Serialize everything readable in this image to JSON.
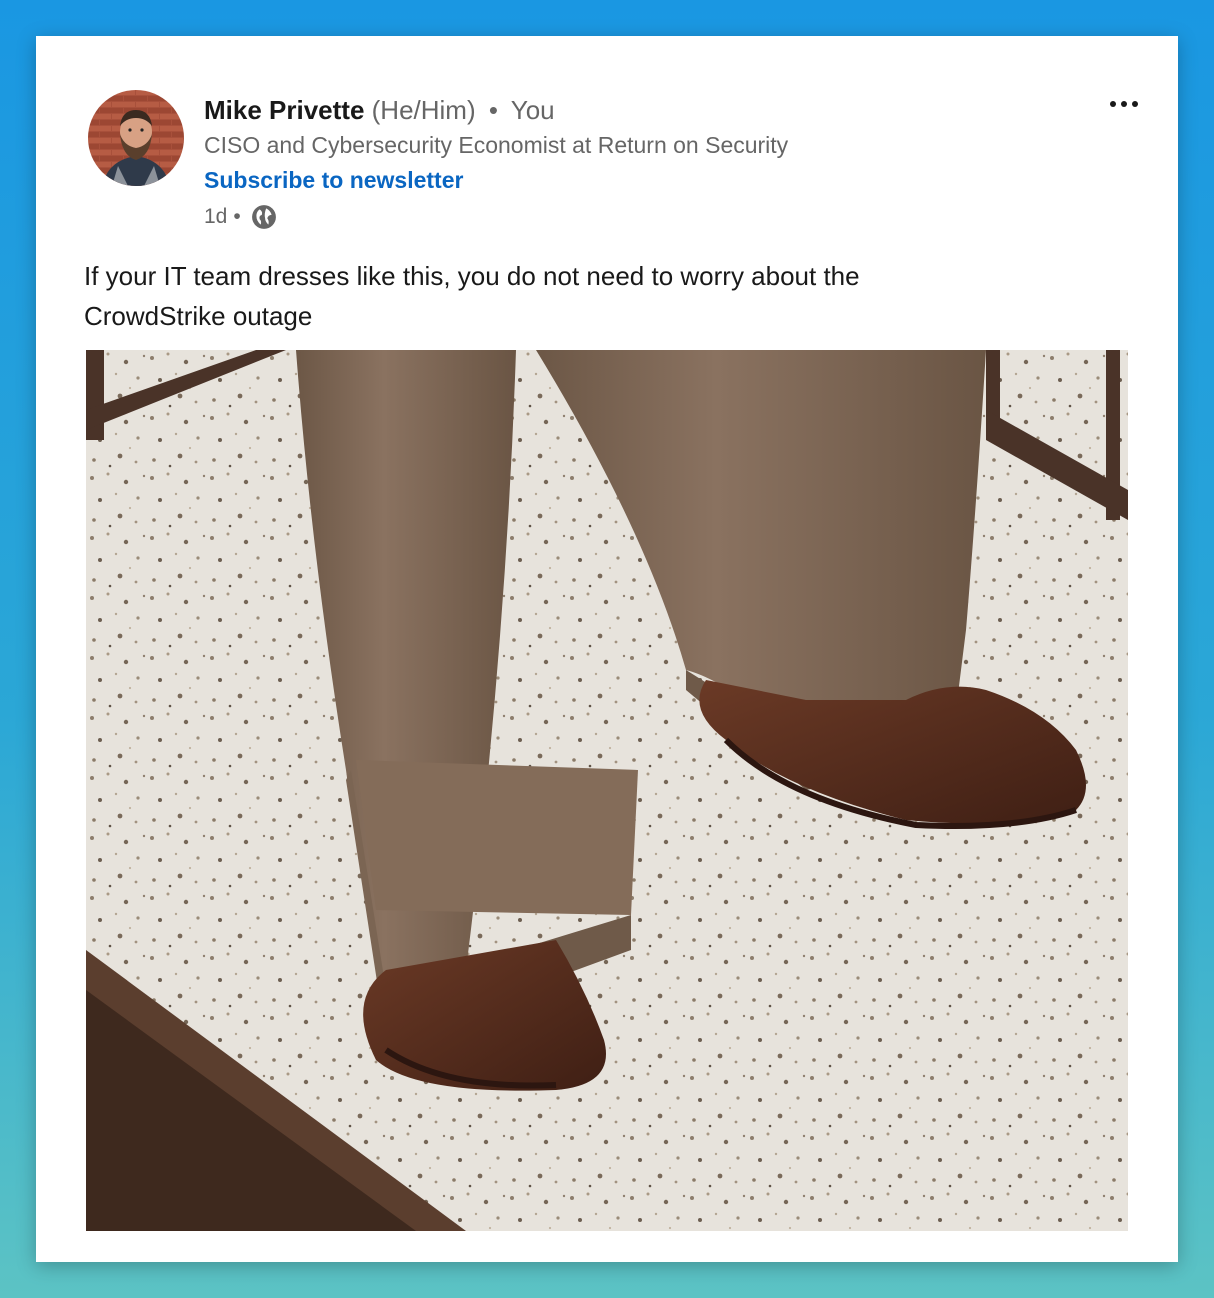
{
  "post": {
    "author": {
      "name": "Mike Privette",
      "pronouns": "(He/Him)",
      "connection": "You",
      "headline": "CISO and Cybersecurity Economist at Return on Security",
      "subscribe_label": "Subscribe to newsletter",
      "time": "1d",
      "visibility_icon": "globe-icon"
    },
    "more_icon": "more-options-icon",
    "text": "If your IT team dresses like this, you do not need to worry about the CrowdStrike outage"
  }
}
